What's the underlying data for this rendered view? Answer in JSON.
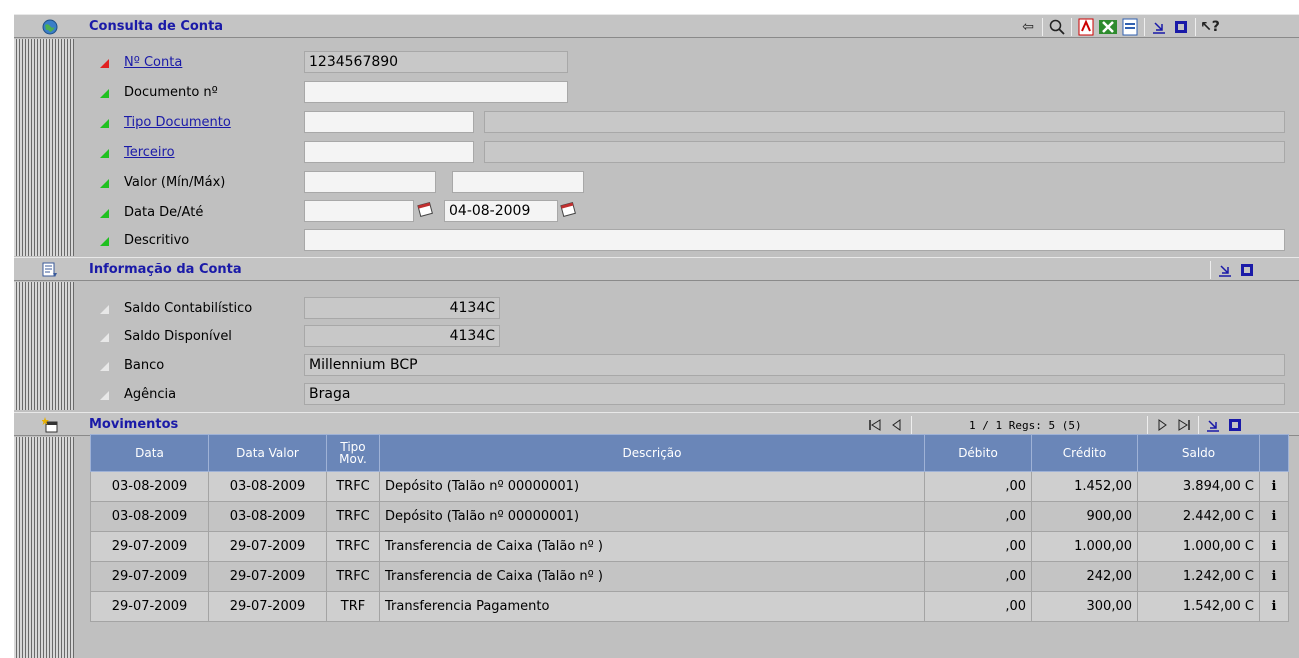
{
  "consulta": {
    "title": "Consulta de Conta",
    "fields": {
      "conta": {
        "label": "Nº Conta",
        "value": "1234567890"
      },
      "documento": {
        "label": "Documento nº",
        "value": ""
      },
      "tipo_documento": {
        "label": "Tipo Documento",
        "value": "",
        "desc": ""
      },
      "terceiro": {
        "label": "Terceiro",
        "value": "",
        "desc": ""
      },
      "valor": {
        "label": "Valor (Mín/Máx)",
        "min": "",
        "max": ""
      },
      "data": {
        "label": "Data De/Até",
        "de": "",
        "ate": "04-08-2009"
      },
      "descritivo": {
        "label": "Descritivo",
        "value": ""
      }
    }
  },
  "informacao": {
    "title": "Informação da Conta",
    "saldo_contabilistico": {
      "label": "Saldo Contabilístico",
      "value": "4134C"
    },
    "saldo_disponivel": {
      "label": "Saldo Disponível",
      "value": "4134C"
    },
    "banco": {
      "label": "Banco",
      "value": "Millennium BCP"
    },
    "agencia": {
      "label": "Agência",
      "value": "Braga"
    }
  },
  "movimentos": {
    "title": "Movimentos",
    "pager": "1 / 1  Regs: 5 (5)",
    "columns": {
      "data": "Data",
      "data_valor": "Data Valor",
      "tipo_mov_1": "Tipo",
      "tipo_mov_2": "Mov.",
      "descricao": "Descrição",
      "debito": "Débito",
      "credito": "Crédito",
      "saldo": "Saldo"
    },
    "rows": [
      {
        "data": "03-08-2009",
        "data_valor": "03-08-2009",
        "tipo": "TRFC",
        "descricao": "Depósito (Talão nº 00000001)",
        "debito": ",00",
        "credito": "1.452,00",
        "saldo": "3.894,00 C",
        "info": "i"
      },
      {
        "data": "03-08-2009",
        "data_valor": "03-08-2009",
        "tipo": "TRFC",
        "descricao": "Depósito (Talão nº 00000001)",
        "debito": ",00",
        "credito": "900,00",
        "saldo": "2.442,00 C",
        "info": "i"
      },
      {
        "data": "29-07-2009",
        "data_valor": "29-07-2009",
        "tipo": "TRFC",
        "descricao": "Transferencia de Caixa (Talão nº )",
        "debito": ",00",
        "credito": "1.000,00",
        "saldo": "1.000,00 C",
        "info": "i"
      },
      {
        "data": "29-07-2009",
        "data_valor": "29-07-2009",
        "tipo": "TRFC",
        "descricao": "Transferencia de Caixa (Talão nº )",
        "debito": ",00",
        "credito": "242,00",
        "saldo": "1.242,00 C",
        "info": "i"
      },
      {
        "data": "29-07-2009",
        "data_valor": "29-07-2009",
        "tipo": "TRF",
        "descricao": "Transferencia Pagamento",
        "debito": ",00",
        "credito": "300,00",
        "saldo": "1.542,00 C",
        "info": "i"
      }
    ]
  },
  "colors": {
    "header_title": "#1a1aa8",
    "table_header": "#6a86b8",
    "marker_required": "#e02020",
    "marker_optional": "#20c020"
  }
}
